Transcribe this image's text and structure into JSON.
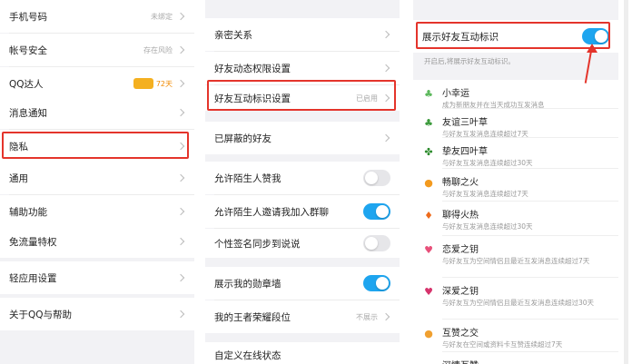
{
  "left_panel": {
    "items": [
      {
        "label": "手机号码",
        "value": "未绑定"
      },
      {
        "label": "帐号安全",
        "value": "存在风险"
      },
      {
        "label": "QQ达人",
        "value": "72天"
      },
      {
        "label": "消息通知",
        "value": ""
      },
      {
        "label": "隐私",
        "value": ""
      },
      {
        "label": "通用",
        "value": ""
      },
      {
        "label": "辅助功能",
        "value": ""
      },
      {
        "label": "免流量特权",
        "value": ""
      },
      {
        "label": "轻应用设置",
        "value": ""
      },
      {
        "label": "关于QQ与帮助",
        "value": ""
      }
    ]
  },
  "middle_panel": {
    "items": [
      {
        "label": "亲密关系",
        "value": ""
      },
      {
        "label": "好友动态权限设置",
        "value": ""
      },
      {
        "label": "好友互动标识设置",
        "value": "已启用"
      },
      {
        "label": "已屏蔽的好友",
        "value": ""
      },
      {
        "label": "允许陌生人赞我",
        "toggle": "off"
      },
      {
        "label": "允许陌生人邀请我加入群聊",
        "toggle": "on"
      },
      {
        "label": "个性签名同步到说说",
        "toggle": "off"
      },
      {
        "label": "展示我的勋章墙",
        "toggle": "on"
      },
      {
        "label": "我的王者荣耀段位",
        "value": "不展示"
      },
      {
        "label": "自定义在线状态",
        "value": ""
      }
    ]
  },
  "right_panel": {
    "main_toggle_label": "展示好友互动标识",
    "main_toggle_state": "on",
    "hint": "开启后,将展示好友互动标识。",
    "marks": [
      {
        "name": "小幸运",
        "desc": "成为新朋友并在当天成功互发消息",
        "icon": "clover-icon"
      },
      {
        "name": "友谊三叶草",
        "desc": "与好友互发消息连续超过7天",
        "icon": "three-leaf-clover-icon"
      },
      {
        "name": "挚友四叶草",
        "desc": "与好友互发消息连续超过30天",
        "icon": "four-leaf-clover-icon"
      },
      {
        "name": "畅聊之火",
        "desc": "与好友互发消息连续超过7天",
        "icon": "small-fire-icon"
      },
      {
        "name": "聊得火热",
        "desc": "与好友互发消息连续超过30天",
        "icon": "big-fire-icon"
      },
      {
        "name": "恋爱之钥",
        "desc": "与好友互为空间情侣且最近互发消息连续超过7天",
        "icon": "heart-key-icon"
      },
      {
        "name": "深爱之钥",
        "desc": "与好友互为空间情侣且最近互发消息连续超过30天",
        "icon": "deep-heart-key-icon"
      },
      {
        "name": "互赞之交",
        "desc": "与好友在空间或资料卡互赞连续超过7天",
        "icon": "thumb-icon"
      },
      {
        "name": "深情互赞",
        "desc": "",
        "icon": "thumb-icon"
      }
    ]
  },
  "colors": {
    "accent": "#1ea5ef",
    "highlight": "#e4342b"
  }
}
